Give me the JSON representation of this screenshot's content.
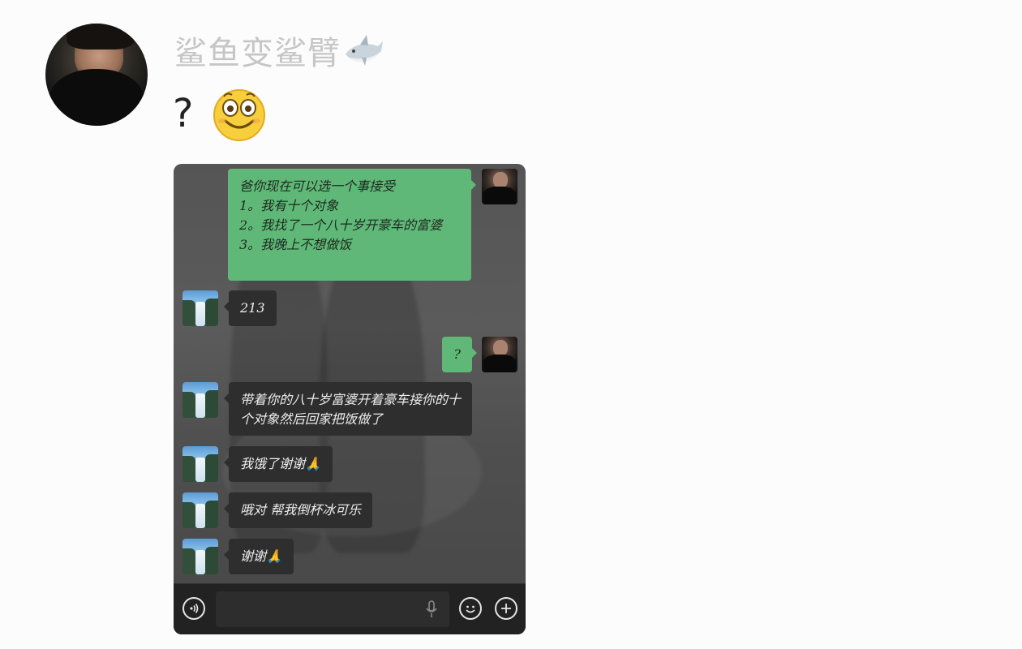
{
  "post": {
    "username": "鲨鱼变鲨臂",
    "text": "?",
    "author_icon": "shark-emoji",
    "text_icon": "smiling-face-emoji"
  },
  "chat": {
    "messages": [
      {
        "sender": "me",
        "text": "爸你现在可以选一个事接受\n1。我有十个对象\n2。我找了一个八十岁开豪车的富婆\n3。我晚上不想做饭"
      },
      {
        "sender": "friend",
        "text": "213"
      },
      {
        "sender": "me",
        "text": "?"
      },
      {
        "sender": "friend",
        "text": "带着你的八十岁富婆开着豪车接你的十个对象然后回家把饭做了"
      },
      {
        "sender": "friend",
        "text": "我饿了谢谢🙏"
      },
      {
        "sender": "friend",
        "text": "哦对 帮我倒杯冰可乐"
      },
      {
        "sender": "friend",
        "text": "谢谢🙏"
      }
    ],
    "input_bar": {
      "voice_icon": "voice-icon",
      "mic_icon": "microphone-icon",
      "emoji_icon": "emoji-icon",
      "plus_icon": "plus-icon"
    },
    "colors": {
      "my_bubble": "#5fb878",
      "friend_bubble": "#2e2e2e",
      "bar": "#222222"
    }
  }
}
